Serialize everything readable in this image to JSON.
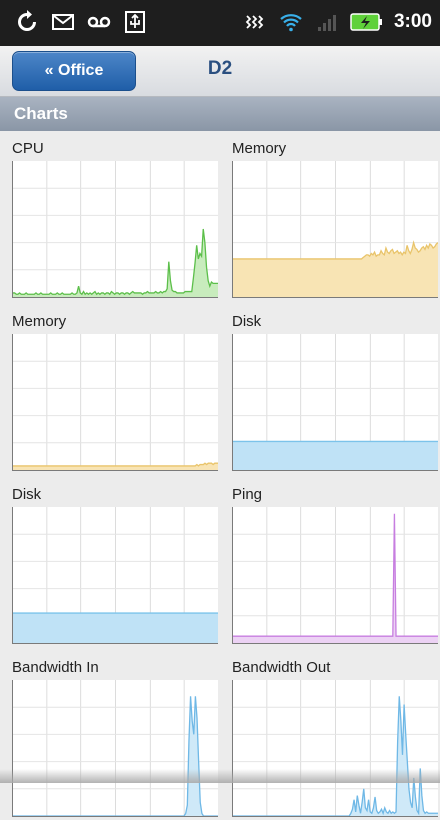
{
  "status": {
    "time": "3:00"
  },
  "nav": {
    "back_label": "« Office",
    "title": "D2"
  },
  "section": {
    "title": "Charts"
  },
  "chart_data": [
    {
      "type": "area",
      "title": "CPU",
      "stroke": "#5cbf4a",
      "fill": "#c8ecbd",
      "ylim": [
        0,
        100
      ],
      "values": [
        3,
        3,
        2,
        2,
        3,
        2,
        2,
        2,
        3,
        2,
        2,
        2,
        2,
        2,
        3,
        2,
        2,
        3,
        2,
        2,
        2,
        2,
        2,
        3,
        2,
        2,
        2,
        3,
        2,
        2,
        3,
        2,
        2,
        2,
        2,
        2,
        3,
        2,
        2,
        3,
        8,
        3,
        2,
        4,
        2,
        3,
        2,
        3,
        2,
        3,
        4,
        2,
        3,
        2,
        3,
        3,
        2,
        3,
        3,
        2,
        4,
        3,
        2,
        3,
        3,
        2,
        3,
        3,
        2,
        3,
        3,
        2,
        3,
        4,
        3,
        3,
        3,
        3,
        3,
        2,
        3,
        3,
        4,
        3,
        3,
        3,
        3,
        4,
        3,
        3,
        4,
        3,
        4,
        4,
        6,
        26,
        12,
        5,
        4,
        4,
        3,
        3,
        3,
        3,
        3,
        4,
        4,
        4,
        4,
        4,
        14,
        25,
        38,
        28,
        32,
        30,
        50,
        40,
        22,
        12,
        8,
        11,
        10,
        10,
        10,
        10
      ]
    },
    {
      "type": "area",
      "title": "Memory",
      "stroke": "#e9c46a",
      "fill": "#f8e4b4",
      "ylim": [
        0,
        100
      ],
      "values": [
        28,
        28,
        28,
        28,
        28,
        28,
        28,
        28,
        28,
        28,
        28,
        28,
        28,
        28,
        28,
        28,
        28,
        28,
        28,
        28,
        28,
        28,
        28,
        28,
        28,
        28,
        28,
        28,
        28,
        28,
        28,
        28,
        28,
        28,
        28,
        28,
        28,
        28,
        28,
        28,
        28,
        28,
        28,
        28,
        28,
        28,
        28,
        28,
        28,
        28,
        28,
        28,
        28,
        28,
        28,
        28,
        28,
        28,
        28,
        28,
        28,
        28,
        28,
        28,
        28,
        28,
        28,
        28,
        28,
        28,
        28,
        28,
        28,
        28,
        28,
        28,
        28,
        28,
        28,
        28,
        29,
        30,
        31,
        31,
        30,
        32,
        31,
        33,
        30,
        31,
        31,
        34,
        32,
        31,
        36,
        33,
        32,
        34,
        35,
        32,
        33,
        34,
        32,
        33,
        31,
        33,
        32,
        38,
        34,
        32,
        35,
        40,
        36,
        35,
        33,
        34,
        36,
        37,
        35,
        38,
        36,
        39,
        38,
        36,
        37,
        39,
        40
      ]
    },
    {
      "type": "area",
      "title": "Memory",
      "stroke": "#e9c46a",
      "fill": "#f8e4b4",
      "ylim": [
        0,
        100
      ],
      "values": [
        3,
        3,
        3,
        3,
        3,
        3,
        3,
        3,
        3,
        3,
        3,
        3,
        3,
        3,
        3,
        3,
        3,
        3,
        3,
        3,
        3,
        3,
        3,
        3,
        3,
        3,
        3,
        3,
        3,
        3,
        3,
        3,
        3,
        3,
        3,
        3,
        3,
        3,
        3,
        3,
        3,
        3,
        3,
        3,
        3,
        3,
        3,
        3,
        3,
        3,
        3,
        3,
        3,
        3,
        3,
        3,
        3,
        3,
        3,
        3,
        3,
        3,
        3,
        3,
        3,
        3,
        3,
        3,
        3,
        3,
        3,
        3,
        3,
        3,
        3,
        3,
        3,
        3,
        3,
        3,
        3,
        3,
        3,
        3,
        3,
        3,
        3,
        3,
        3,
        3,
        3,
        3,
        3,
        3,
        3,
        3,
        3,
        3,
        3,
        3,
        3,
        3,
        3,
        3,
        3,
        3,
        3,
        3,
        3,
        3,
        3,
        3,
        3,
        4,
        3,
        4,
        4,
        4,
        5,
        4,
        5,
        5,
        5,
        4,
        5,
        5,
        5
      ]
    },
    {
      "type": "area",
      "title": "Disk",
      "stroke": "#7cc3ea",
      "fill": "#bfe2f6",
      "ylim": [
        0,
        100
      ],
      "values": [
        21,
        21,
        21,
        21,
        21,
        21,
        21,
        21,
        21,
        21,
        21,
        21,
        21,
        21,
        21,
        21,
        21,
        21,
        21,
        21,
        21,
        21,
        21,
        21,
        21,
        21,
        21,
        21,
        21,
        21,
        21,
        21,
        21,
        21,
        21,
        21,
        21,
        21,
        21,
        21,
        21,
        21,
        21,
        21,
        21,
        21,
        21,
        21,
        21,
        21,
        21,
        21,
        21,
        21,
        21,
        21,
        21,
        21,
        21,
        21,
        21,
        21,
        21,
        21,
        21,
        21,
        21,
        21,
        21,
        21,
        21,
        21,
        21,
        21,
        21,
        21,
        21,
        21,
        21,
        21,
        21,
        21,
        21,
        21,
        21,
        21,
        21,
        21,
        21,
        21,
        21,
        21,
        21,
        21,
        21,
        21,
        21,
        21,
        21,
        21,
        21,
        21,
        21,
        21,
        21,
        21,
        21,
        21,
        21,
        21,
        21,
        21,
        21,
        21,
        21,
        21,
        21,
        21,
        21,
        21,
        21,
        21,
        21,
        21,
        21,
        21,
        21,
        21
      ]
    },
    {
      "type": "area",
      "title": "Disk",
      "stroke": "#7cc3ea",
      "fill": "#bfe2f6",
      "ylim": [
        0,
        100
      ],
      "values": [
        22,
        22,
        22,
        22,
        22,
        22,
        22,
        22,
        22,
        22,
        22,
        22,
        22,
        22,
        22,
        22,
        22,
        22,
        22,
        22,
        22,
        22,
        22,
        22,
        22,
        22,
        22,
        22,
        22,
        22,
        22,
        22,
        22,
        22,
        22,
        22,
        22,
        22,
        22,
        22,
        22,
        22,
        22,
        22,
        22,
        22,
        22,
        22,
        22,
        22,
        22,
        22,
        22,
        22,
        22,
        22,
        22,
        22,
        22,
        22,
        22,
        22,
        22,
        22,
        22,
        22,
        22,
        22,
        22,
        22,
        22,
        22,
        22,
        22,
        22,
        22,
        22,
        22,
        22,
        22,
        22,
        22,
        22,
        22,
        22,
        22,
        22,
        22,
        22,
        22,
        22,
        22,
        22,
        22,
        22,
        22,
        22,
        22,
        22,
        22,
        22,
        22,
        22,
        22,
        22,
        22,
        22,
        22,
        22,
        22,
        22,
        22,
        22,
        22,
        22,
        22,
        22,
        22,
        22,
        22,
        22,
        22,
        22,
        22,
        22,
        22,
        22,
        22
      ]
    },
    {
      "type": "area",
      "title": "Ping",
      "stroke": "#c77ee0",
      "fill": "#ecd2f4",
      "ylim": [
        0,
        100
      ],
      "values": [
        5,
        5,
        5,
        5,
        5,
        5,
        5,
        5,
        5,
        5,
        5,
        5,
        5,
        5,
        5,
        5,
        5,
        5,
        5,
        5,
        5,
        5,
        5,
        5,
        5,
        5,
        5,
        5,
        5,
        5,
        5,
        5,
        5,
        5,
        5,
        5,
        5,
        5,
        5,
        5,
        5,
        5,
        5,
        5,
        5,
        5,
        5,
        5,
        5,
        5,
        5,
        5,
        5,
        5,
        5,
        5,
        5,
        5,
        5,
        5,
        5,
        5,
        5,
        5,
        5,
        5,
        5,
        5,
        5,
        5,
        5,
        5,
        5,
        5,
        5,
        5,
        5,
        5,
        5,
        5,
        5,
        5,
        5,
        5,
        5,
        5,
        5,
        5,
        5,
        5,
        5,
        5,
        5,
        5,
        5,
        5,
        5,
        5,
        5,
        5,
        95,
        5,
        5,
        5,
        5,
        5,
        5,
        5,
        5,
        5,
        5,
        5,
        5,
        5,
        5,
        5,
        5,
        5,
        5,
        5,
        5,
        5,
        5,
        5,
        5,
        5,
        5,
        5
      ]
    },
    {
      "type": "area",
      "title": "Bandwidth In",
      "stroke": "#6fb8e6",
      "fill": "#cfe9f8",
      "ylim": [
        0,
        100
      ],
      "values": [
        0,
        0,
        0,
        0,
        0,
        0,
        0,
        0,
        0,
        0,
        0,
        0,
        0,
        0,
        0,
        0,
        0,
        0,
        0,
        0,
        0,
        0,
        0,
        0,
        0,
        0,
        0,
        0,
        0,
        0,
        0,
        0,
        0,
        0,
        0,
        0,
        0,
        0,
        0,
        0,
        0,
        0,
        0,
        0,
        0,
        0,
        0,
        0,
        0,
        0,
        0,
        0,
        0,
        0,
        0,
        0,
        0,
        0,
        0,
        0,
        0,
        0,
        0,
        0,
        0,
        0,
        0,
        0,
        0,
        0,
        0,
        0,
        0,
        0,
        0,
        0,
        0,
        0,
        0,
        0,
        0,
        0,
        0,
        0,
        0,
        0,
        0,
        0,
        0,
        0,
        0,
        0,
        0,
        0,
        0,
        0,
        0,
        0,
        0,
        0,
        0,
        0,
        0,
        0,
        0,
        0,
        0,
        2,
        8,
        55,
        88,
        70,
        60,
        88,
        72,
        40,
        10,
        2,
        0,
        0,
        0,
        0,
        0,
        0,
        0,
        0,
        0,
        0
      ]
    },
    {
      "type": "area",
      "title": "Bandwidth Out",
      "stroke": "#6fb8e6",
      "fill": "#cfe9f8",
      "ylim": [
        0,
        100
      ],
      "values": [
        0,
        0,
        0,
        0,
        0,
        0,
        0,
        0,
        0,
        0,
        0,
        0,
        0,
        0,
        0,
        0,
        0,
        0,
        0,
        0,
        0,
        0,
        0,
        0,
        0,
        0,
        0,
        0,
        0,
        0,
        0,
        0,
        0,
        0,
        0,
        0,
        0,
        0,
        0,
        0,
        0,
        0,
        0,
        0,
        0,
        0,
        0,
        0,
        0,
        0,
        0,
        0,
        0,
        0,
        0,
        0,
        0,
        0,
        0,
        0,
        0,
        0,
        0,
        0,
        0,
        0,
        0,
        0,
        0,
        0,
        0,
        0,
        0,
        2,
        5,
        12,
        3,
        15,
        8,
        2,
        10,
        20,
        6,
        4,
        12,
        3,
        2,
        6,
        14,
        4,
        2,
        3,
        5,
        2,
        6,
        3,
        2,
        4,
        2,
        3,
        2,
        3,
        55,
        88,
        70,
        45,
        82,
        60,
        40,
        20,
        10,
        6,
        28,
        14,
        4,
        2,
        35,
        15,
        4,
        2,
        3,
        2,
        2,
        2,
        2,
        2,
        2,
        2
      ]
    }
  ]
}
